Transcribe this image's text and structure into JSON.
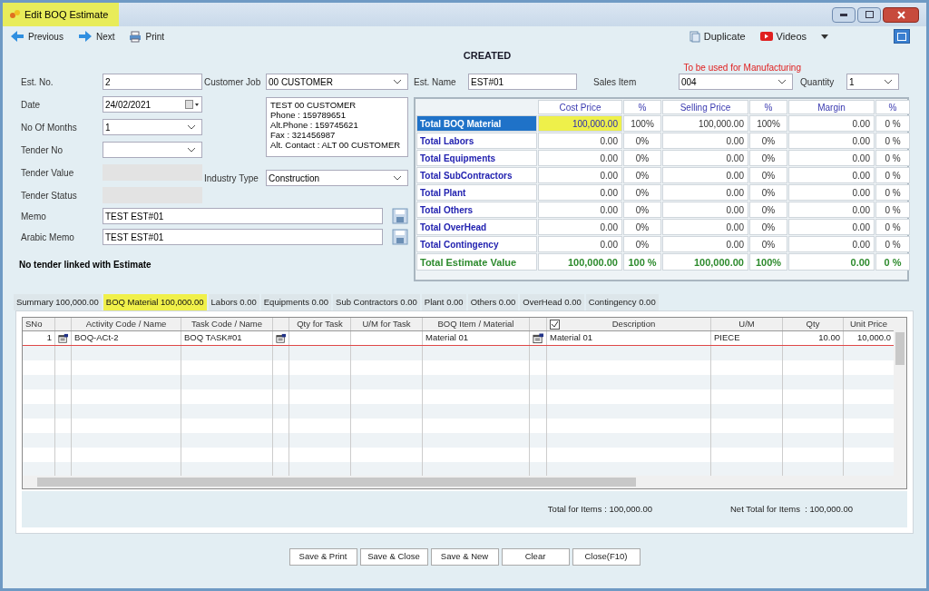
{
  "window": {
    "title": "Edit BOQ Estimate"
  },
  "toolbar": [
    {
      "label": "Previous",
      "kind": "previous"
    },
    {
      "label": "Next",
      "kind": "next"
    },
    {
      "label": "Print",
      "kind": "print"
    }
  ],
  "toolbar_right": [
    {
      "label": "Duplicate",
      "kind": "duplicate"
    },
    {
      "label": "Videos",
      "kind": "videos"
    }
  ],
  "status": "CREATED",
  "manufacturing_note": "To be used for Manufacturing",
  "form": {
    "est_no": {
      "label": "Est. No.",
      "value": "2"
    },
    "date": {
      "label": "Date",
      "value": "24/02/2021"
    },
    "no_of_months": {
      "label": "No Of Months",
      "value": "1"
    },
    "tender_no": {
      "label": "Tender No"
    },
    "tender_value": {
      "label": "Tender Value"
    },
    "tender_status": {
      "label": "Tender Status"
    },
    "memo": {
      "label": "Memo",
      "value": "TEST EST#01"
    },
    "arabic_memo": {
      "label": "Arabic Memo",
      "value": "TEST EST#01"
    },
    "customer_job": {
      "label": "Customer Job",
      "value": "00 CUSTOMER"
    },
    "customer_info": [
      "TEST 00 CUSTOMER",
      "Phone : 159789651",
      "Alt.Phone : 159745621",
      "Fax : 321456987",
      "Alt. Contact : ALT 00 CUSTOMER"
    ],
    "industry_type": {
      "label": "Industry Type",
      "value": "Construction"
    },
    "est_name": {
      "label": "Est. Name",
      "value": "EST#01"
    },
    "sales_item": {
      "label": "Sales Item",
      "value": "004"
    },
    "quantity": {
      "label": "Quantity",
      "value": "1"
    },
    "tender_note": "No tender linked with Estimate"
  },
  "summary": {
    "columns": [
      "Cost Price",
      "%",
      "Selling Price",
      "%",
      "Margin",
      "%"
    ],
    "rows": [
      {
        "label": "Total BOQ Material",
        "selected": true,
        "highlighted": true,
        "cells": [
          "100,000.00",
          "100%",
          "100,000.00",
          "100%",
          "0.00",
          "0 %"
        ]
      },
      {
        "label": "Total Labors",
        "selected": false,
        "highlighted": false,
        "cells": [
          "0.00",
          "0%",
          "0.00",
          "0%",
          "0.00",
          "0 %"
        ]
      },
      {
        "label": "Total Equipments",
        "selected": false,
        "highlighted": false,
        "cells": [
          "0.00",
          "0%",
          "0.00",
          "0%",
          "0.00",
          "0 %"
        ]
      },
      {
        "label": "Total SubContractors",
        "selected": false,
        "highlighted": false,
        "cells": [
          "0.00",
          "0%",
          "0.00",
          "0%",
          "0.00",
          "0 %"
        ]
      },
      {
        "label": "Total Plant",
        "selected": false,
        "highlighted": false,
        "cells": [
          "0.00",
          "0%",
          "0.00",
          "0%",
          "0.00",
          "0 %"
        ]
      },
      {
        "label": "Total Others",
        "selected": false,
        "highlighted": false,
        "cells": [
          "0.00",
          "0%",
          "0.00",
          "0%",
          "0.00",
          "0 %"
        ]
      },
      {
        "label": "Total OverHead",
        "selected": false,
        "highlighted": false,
        "cells": [
          "0.00",
          "0%",
          "0.00",
          "0%",
          "0.00",
          "0 %"
        ]
      },
      {
        "label": "Total Contingency",
        "selected": false,
        "highlighted": false,
        "cells": [
          "0.00",
          "0%",
          "0.00",
          "0%",
          "0.00",
          "0 %"
        ]
      }
    ],
    "total": {
      "label": "Total Estimate Value",
      "cells": [
        "100,000.00",
        "100 %",
        "100,000.00",
        "100%",
        "0.00",
        "0 %"
      ]
    }
  },
  "tabs": [
    {
      "label": "Summary 100,000.00",
      "selected": false
    },
    {
      "label": "BOQ Material  100,000.00",
      "selected": true
    },
    {
      "label": "Labors 0.00",
      "selected": false
    },
    {
      "label": "Equipments 0.00",
      "selected": false
    },
    {
      "label": "Sub Contractors 0.00",
      "selected": false
    },
    {
      "label": "Plant  0.00",
      "selected": false
    },
    {
      "label": "Others  0.00",
      "selected": false
    },
    {
      "label": "OverHead 0.00",
      "selected": false
    },
    {
      "label": "Contingency 0.00",
      "selected": false
    }
  ],
  "grid": {
    "columns": [
      {
        "label": "SNo",
        "kind": "text"
      },
      {
        "kind": "icon"
      },
      {
        "label": "Activity Code / Name",
        "kind": "text"
      },
      {
        "label": "Task Code / Name",
        "kind": "text"
      },
      {
        "kind": "icon"
      },
      {
        "label": "Qty for Task",
        "kind": "text"
      },
      {
        "label": "U/M for Task",
        "kind": "text"
      },
      {
        "label": "BOQ Item / Material",
        "kind": "text"
      },
      {
        "kind": "icon"
      },
      {
        "label": "Description",
        "kind": "check"
      },
      {
        "label": "U/M",
        "kind": "text"
      },
      {
        "label": "Qty",
        "kind": "text"
      },
      {
        "label": "Unit Price",
        "kind": "text"
      }
    ],
    "check_all": true,
    "rows": [
      {
        "cells": [
          "1",
          null,
          "BOQ-ACt-2",
          "BOQ TASK#01",
          null,
          null,
          null,
          "Material 01",
          null,
          "Material 01",
          "PIECE",
          "10.00",
          "10,000.0"
        ]
      }
    ]
  },
  "totals": [
    {
      "label": "Total for Items : 100,000.00"
    },
    {
      "label": "Net Total for Items  : 100,000.00"
    }
  ],
  "buttons": [
    "Save & Print",
    "Save & Close",
    "Save & New",
    "Clear",
    "Close(F10)"
  ]
}
